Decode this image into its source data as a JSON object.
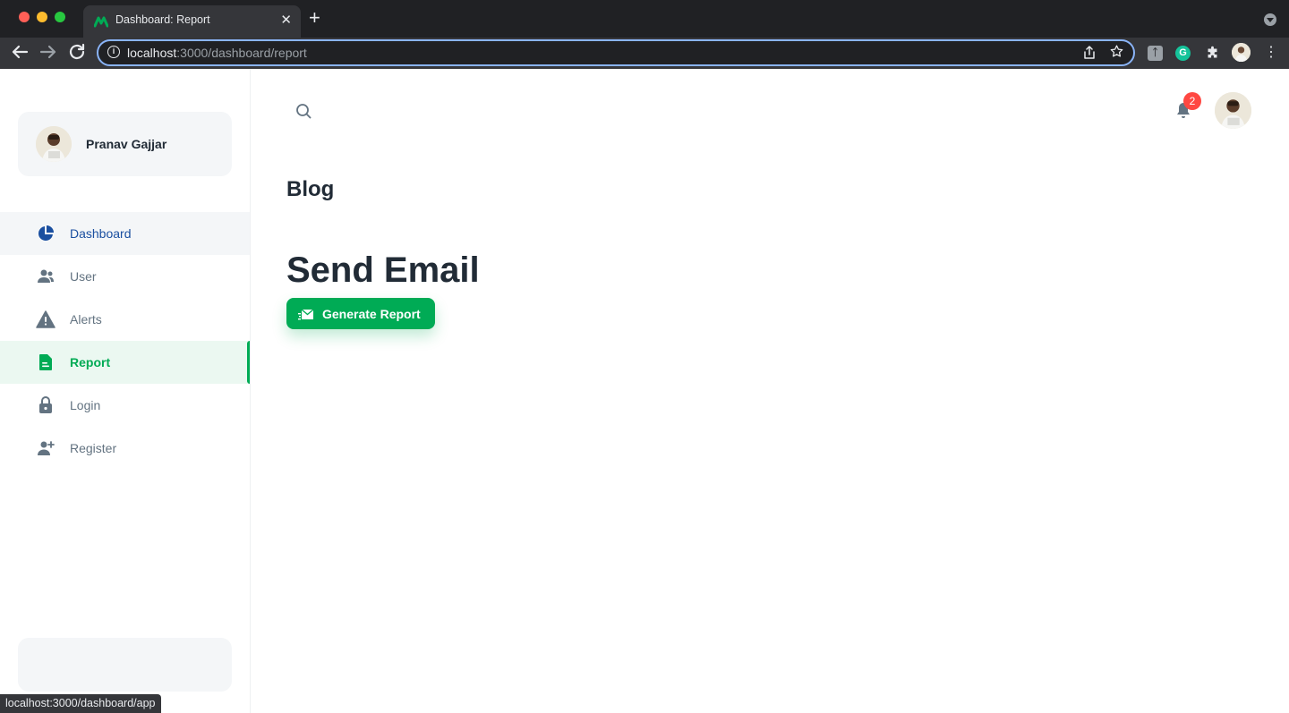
{
  "browser": {
    "tab_title": "Dashboard: Report",
    "tab_close": "✕",
    "new_tab": "+",
    "url_host": "localhost",
    "url_path": ":3000/dashboard/report",
    "ext_1": "ᛏ",
    "ext_2": "G",
    "status_url": "localhost:3000/dashboard/app"
  },
  "sidebar": {
    "account_name": "Pranav Gajjar",
    "items": [
      {
        "label": "Dashboard",
        "icon": "pie-chart-icon",
        "state": "hover"
      },
      {
        "label": "User",
        "icon": "people-icon",
        "state": ""
      },
      {
        "label": "Alerts",
        "icon": "alert-triangle-icon",
        "state": ""
      },
      {
        "label": "Report",
        "icon": "file-text-icon",
        "state": "active"
      },
      {
        "label": "Login",
        "icon": "lock-icon",
        "state": ""
      },
      {
        "label": "Register",
        "icon": "person-add-icon",
        "state": ""
      }
    ]
  },
  "header": {
    "notification_count": "2"
  },
  "main": {
    "page_title": "Blog",
    "section_title": "Send Email",
    "generate_button_label": "Generate Report"
  },
  "colors": {
    "primary": "#00ab55",
    "dashboard_hover": "#1a4fa0",
    "badge": "#ff4842",
    "text_primary": "#212b36",
    "text_secondary": "#637381"
  }
}
